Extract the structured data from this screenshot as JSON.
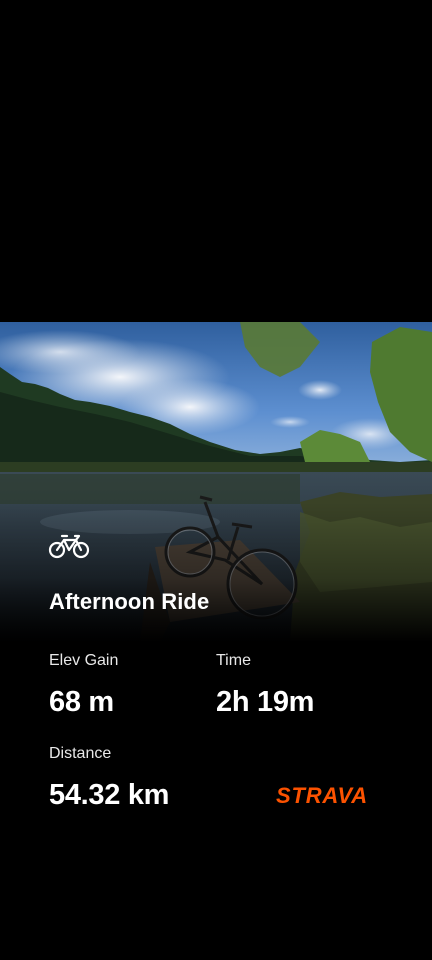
{
  "activity": {
    "type_icon": "bike-icon",
    "title": "Afternoon Ride"
  },
  "stats": {
    "elev_gain": {
      "label": "Elev Gain",
      "value": "68 m"
    },
    "time": {
      "label": "Time",
      "value": "2h 19m"
    },
    "distance": {
      "label": "Distance",
      "value": "54.32 km"
    }
  },
  "brand": {
    "name": "STRAVA",
    "color": "#fc5200"
  },
  "colors": {
    "background": "#000000",
    "text": "#ffffff"
  }
}
